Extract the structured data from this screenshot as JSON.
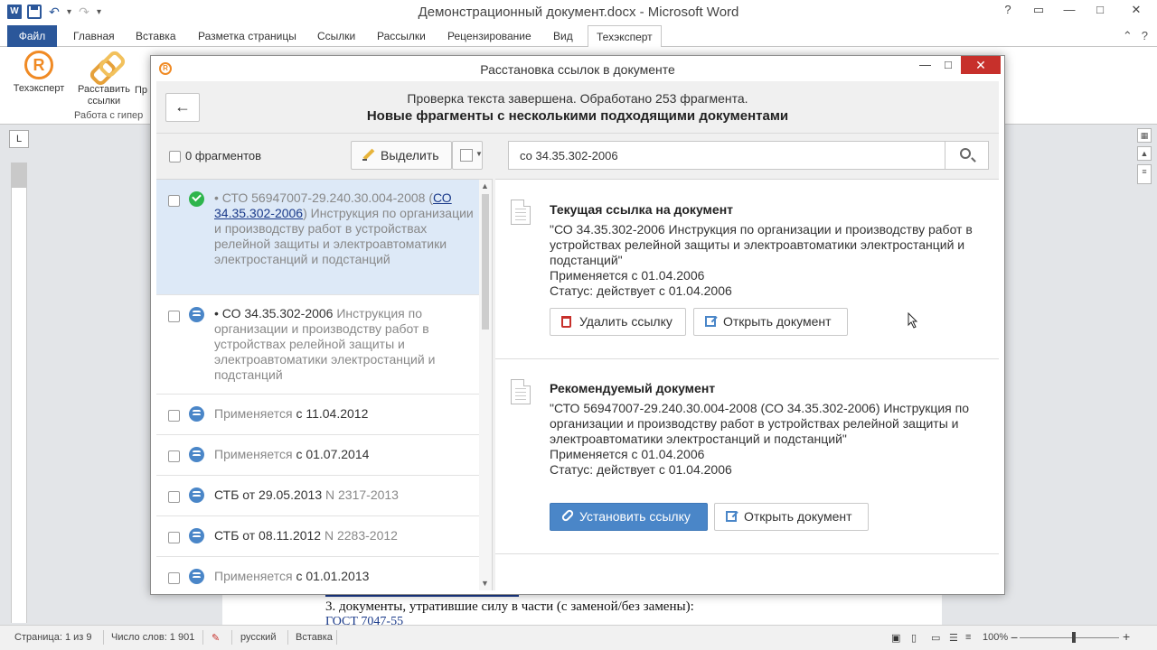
{
  "word": {
    "title": "Демонстрационный документ.docx - Microsoft Word",
    "logo_letter": "W",
    "tabs": [
      "Файл",
      "Главная",
      "Вставка",
      "Разметка страницы",
      "Ссылки",
      "Рассылки",
      "Рецензирование",
      "Вид",
      "Техэксперт"
    ],
    "active_tab": "Техэксперт",
    "ribbon": {
      "btn_techexpert": "Техэксперт",
      "btn_place_links_1": "Расставить",
      "btn_place_links_2": "ссылки",
      "btn_partial": "Пр",
      "group_label": "Работа с гипер"
    },
    "ruler_corner": "L",
    "page": {
      "line": "3. документы, утратившие силу в части (с заменой/без замены):",
      "link": "ГОСТ 7047-55"
    },
    "status": {
      "page": "Страница: 1 из 9",
      "words": "Число слов: 1 901",
      "language": "русский",
      "mode": "Вставка",
      "zoom": "100%"
    }
  },
  "dialog": {
    "title": "Расстановка ссылок в документе",
    "header_sub": "Проверка текста завершена. Обработано 253 фрагмента.",
    "header_main": "Новые фрагменты с несколькими подходящими документами",
    "fragments_label": "0 фрагментов",
    "select_button": "Выделить",
    "search_value": "со 34.35.302-2006",
    "list": [
      {
        "bullet_code": "• СТО 56947007-29.240.30.004-2008 (",
        "link": "СО 34.35.302-2006",
        "rest": ") Инструкция по организации и производству работ в устройствах релейной защиты и электроавтоматики электростанций и подстанций",
        "status": "ok"
      },
      {
        "bullet_code": "• СО 34.35.302-2006",
        "rest": " Инструкция по организации и производству работ в устройствах релейной защиты и электроавтоматики электростанций и подстанций",
        "status": "stack"
      },
      {
        "grey": "Применяется",
        "dark": " с 11.04.2012",
        "status": "stack"
      },
      {
        "grey": "Применяется",
        "dark": " с 01.07.2014",
        "status": "stack"
      },
      {
        "dark": "СТБ от 29.05.2013",
        "grey": " N 2317-2013",
        "status": "stack"
      },
      {
        "dark": "СТБ от 08.11.2012",
        "grey": " N 2283-2012",
        "status": "stack"
      },
      {
        "grey": "Применяется",
        "dark": " с 01.01.2013",
        "status": "stack"
      }
    ],
    "current": {
      "title": "Текущая ссылка на документ",
      "text": "\"СО 34.35.302-2006 Инструкция по организации и производству работ в устройствах релейной защиты и электроавтоматики электростанций и подстанций\"",
      "applies": "Применяется с 01.04.2006",
      "status": "Статус: действует с 01.04.2006",
      "btn_delete": "Удалить ссылку",
      "btn_open": "Открыть документ"
    },
    "recommended": {
      "title": "Рекомендуемый документ",
      "text": "\"СТО 56947007-29.240.30.004-2008 (СО 34.35.302-2006) Инструкция по организации и производству работ в устройствах релейной защиты и электроавтоматики электростанций и подстанций\"",
      "applies": "Применяется с 01.04.2006",
      "status": "Статус: действует с 01.04.2006",
      "btn_set": "Установить ссылку",
      "btn_open": "Открыть документ"
    }
  },
  "colors": {
    "accent": "#2b579a",
    "primary_button": "#4a86c8",
    "close_red": "#c7302b",
    "ok_green": "#2eb54c",
    "brand_orange": "#f08a24"
  }
}
